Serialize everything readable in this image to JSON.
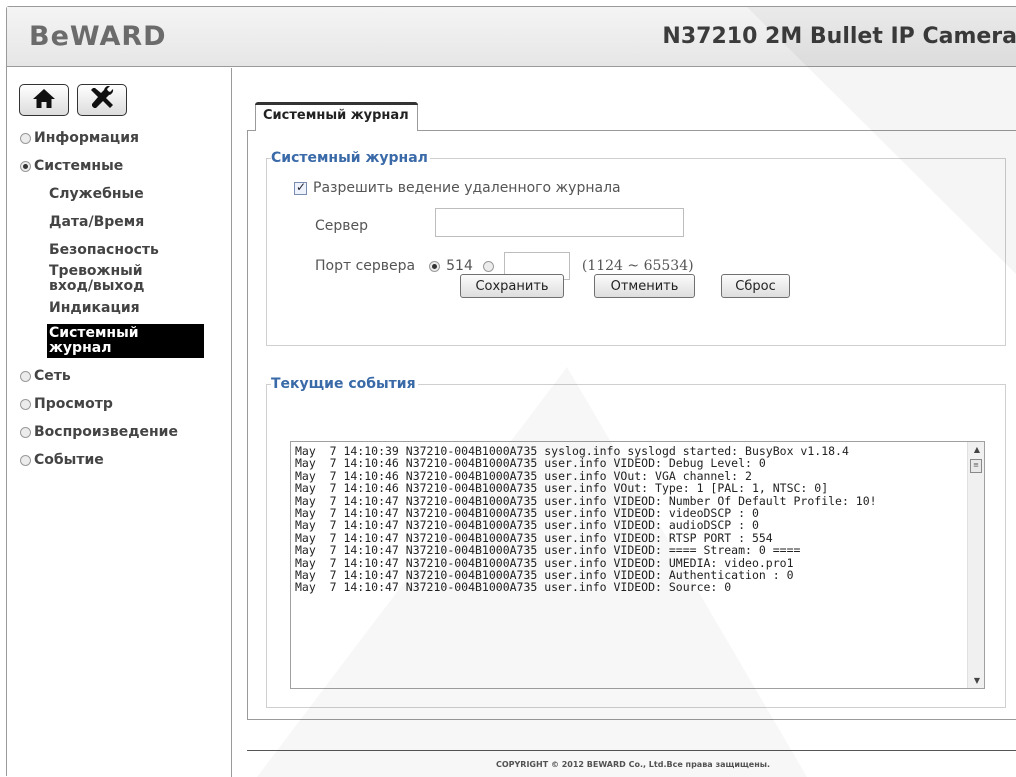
{
  "header": {
    "logo": "BeWARD",
    "camera_title": "N37210 2M Bullet IP Camera"
  },
  "toolbar": {
    "home_icon": "home-icon",
    "settings_icon": "tools-icon"
  },
  "sidebar": {
    "items": [
      {
        "label": "Информация",
        "selected": false
      },
      {
        "label": "Системные",
        "selected": true
      },
      {
        "label": "Сеть",
        "selected": false
      },
      {
        "label": "Просмотр",
        "selected": false
      },
      {
        "label": "Воспроизведение",
        "selected": false
      },
      {
        "label": "Событие",
        "selected": false
      }
    ],
    "subitems": [
      {
        "label": "Служебные"
      },
      {
        "label": "Дата/Время"
      },
      {
        "label": "Безопасность"
      },
      {
        "label": "Тревожный вход/выход"
      },
      {
        "label": "Индикация"
      },
      {
        "label": "Системный журнал",
        "active": true
      }
    ]
  },
  "tab": {
    "label": "Системный журнал"
  },
  "syslog": {
    "legend": "Системный журнал",
    "remote_checkbox_label": "Разрешить ведение удаленного журнала",
    "remote_checked": true,
    "server_label": "Сервер",
    "server_value": "",
    "port_label": "Порт сервера",
    "port_default": "514",
    "port_custom_value": "",
    "port_range": "(1124 ~ 65534)",
    "save_label": "Сохранить",
    "cancel_label": "Отменить",
    "reset_label": "Сброс"
  },
  "events": {
    "legend": "Текущие события",
    "log": "May  7 14:10:39 N37210-004B1000A735 syslog.info syslogd started: BusyBox v1.18.4\nMay  7 14:10:46 N37210-004B1000A735 user.info VIDEOD: Debug Level: 0\nMay  7 14:10:46 N37210-004B1000A735 user.info VOut: VGA channel: 2\nMay  7 14:10:46 N37210-004B1000A735 user.info VOut: Type: 1 [PAL: 1, NTSC: 0]\nMay  7 14:10:47 N37210-004B1000A735 user.info VIDEOD: Number Of Default Profile: 10!\nMay  7 14:10:47 N37210-004B1000A735 user.info VIDEOD: videoDSCP : 0\nMay  7 14:10:47 N37210-004B1000A735 user.info VIDEOD: audioDSCP : 0\nMay  7 14:10:47 N37210-004B1000A735 user.info VIDEOD: RTSP PORT : 554\nMay  7 14:10:47 N37210-004B1000A735 user.info VIDEOD: ==== Stream: 0 ====\nMay  7 14:10:47 N37210-004B1000A735 user.info VIDEOD: UMEDIA: video.pro1\nMay  7 14:10:47 N37210-004B1000A735 user.info VIDEOD: Authentication : 0\nMay  7 14:10:47 N37210-004B1000A735 user.info VIDEOD: Source: 0"
  },
  "footer": {
    "copyright": "COPYRIGHT © 2012 BEWARD Co., Ltd.Все права защищены."
  },
  "colors": {
    "legend": "#3a6aa8",
    "active_nav_bg": "#000000",
    "border": "#9a9a9a"
  }
}
